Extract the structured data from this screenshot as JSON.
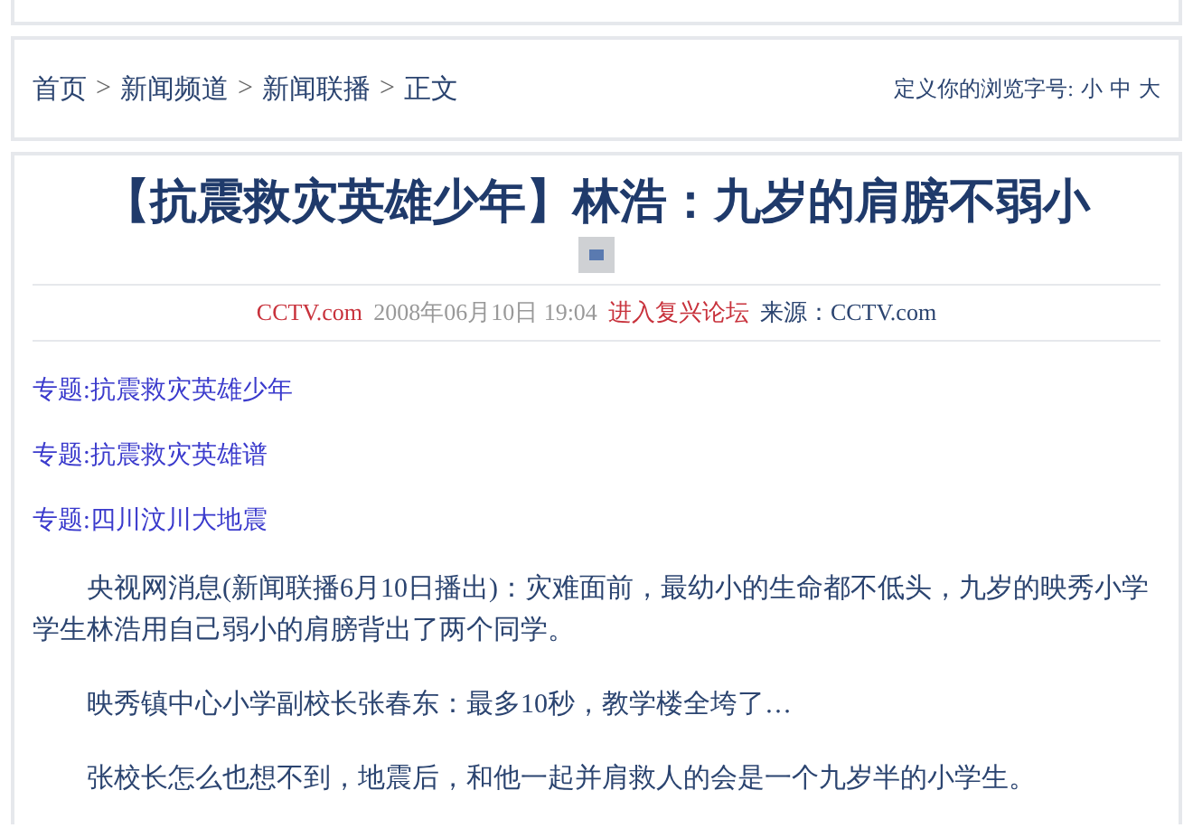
{
  "breadcrumb": [
    "首页",
    "新闻频道",
    "新闻联播",
    "正文"
  ],
  "breadcrumb_separator": ">",
  "font_size_control": {
    "label": "定义你的浏览字号:",
    "options": [
      "小",
      "中",
      "大"
    ]
  },
  "article": {
    "title": "【抗震救灾英雄少年】林浩：九岁的肩膀不弱小",
    "meta": {
      "site": "CCTV.com",
      "datetime": "2008年06月10日 19:04",
      "forum_link": "进入复兴论坛",
      "source_label": "来源：",
      "source": "CCTV.com"
    },
    "topics": [
      "专题:抗震救灾英雄少年",
      "专题:抗震救灾英雄谱",
      "专题:四川汶川大地震"
    ],
    "paragraphs": [
      "央视网消息(新闻联播6月10日播出)：灾难面前，最幼小的生命都不低头，九岁的映秀小学学生林浩用自己弱小的肩膀背出了两个同学。",
      "映秀镇中心小学副校长张春东：最多10秒，教学楼全垮了…",
      "张校长怎么也想不到，地震后，和他一起并肩救人的会是一个九岁半的小学生。"
    ]
  }
}
